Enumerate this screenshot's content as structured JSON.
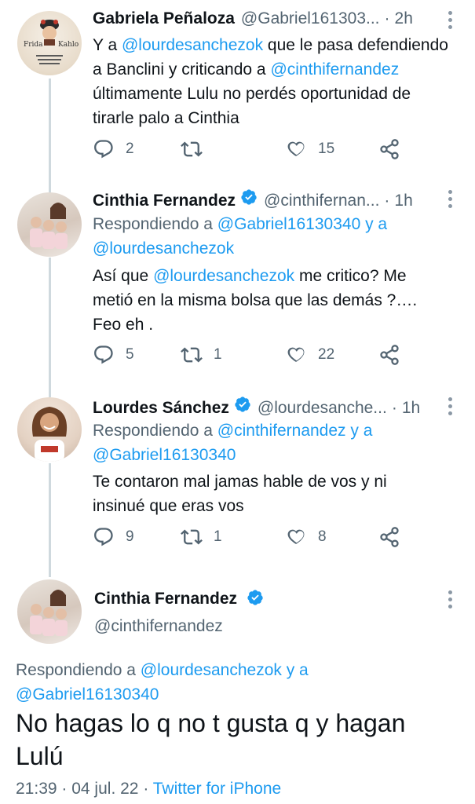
{
  "tweets": [
    {
      "name": "Gabriela Peñaloza",
      "handle": "@Gabriel161303...",
      "time": "2h",
      "avatar_label_1": "Frida",
      "avatar_label_2": "Kahlo",
      "body_pre": "Y a ",
      "body_mention_1": "@lourdesanchezok",
      "body_mid": " que le pasa defendiendo a Banclini y criticando a ",
      "body_mention_2": "@cinthifernandez",
      "body_post": "  últimamente Lulu no perdés oportunidad de tirarle palo a Cinthia",
      "replies": "2",
      "retweets": "",
      "likes": "15"
    },
    {
      "name": "Cinthia Fernandez",
      "handle": "@cinthifernan...",
      "time": "1h",
      "reply_prefix": "Respondiendo a ",
      "reply_mention_1": "@Gabriel16130340",
      "reply_join": " y a",
      "reply_mention_2": "@lourdesanchezok",
      "body_pre": "Así que ",
      "body_mention_1": "@lourdesanchezok",
      "body_post": " me critico? Me metió en la misma bolsa  que las demás ?…. Feo eh .",
      "replies": "5",
      "retweets": "1",
      "likes": "22"
    },
    {
      "name": "Lourdes Sánchez",
      "handle": "@lourdesanche...",
      "time": "1h",
      "reply_prefix": "Respondiendo a ",
      "reply_mention_1": "@cinthifernandez",
      "reply_join": " y a",
      "reply_mention_2": "@Gabriel16130340",
      "body": "Te contaron mal jamas hable de vos y ni insinué que eras vos",
      "replies": "9",
      "retweets": "1",
      "likes": "8"
    }
  ],
  "main_tweet": {
    "name": "Cinthia Fernandez",
    "handle": "@cinthifernandez",
    "reply_prefix": "Respondiendo a ",
    "reply_mention_1": "@lourdesanchezok",
    "reply_join": " y a",
    "reply_mention_2": "@Gabriel16130340",
    "body": "No hagas lo q no t gusta q y hagan Lulú",
    "time": "21:39",
    "date": "04 jul. 22",
    "source": "Twitter for iPhone"
  },
  "colors": {
    "accent": "#1d9bf0",
    "muted": "#536471",
    "text": "#0f1419",
    "thread_line": "#cfd9de"
  },
  "icons": [
    "reply-icon",
    "retweet-icon",
    "like-icon",
    "share-icon",
    "verified-icon",
    "more-icon"
  ]
}
